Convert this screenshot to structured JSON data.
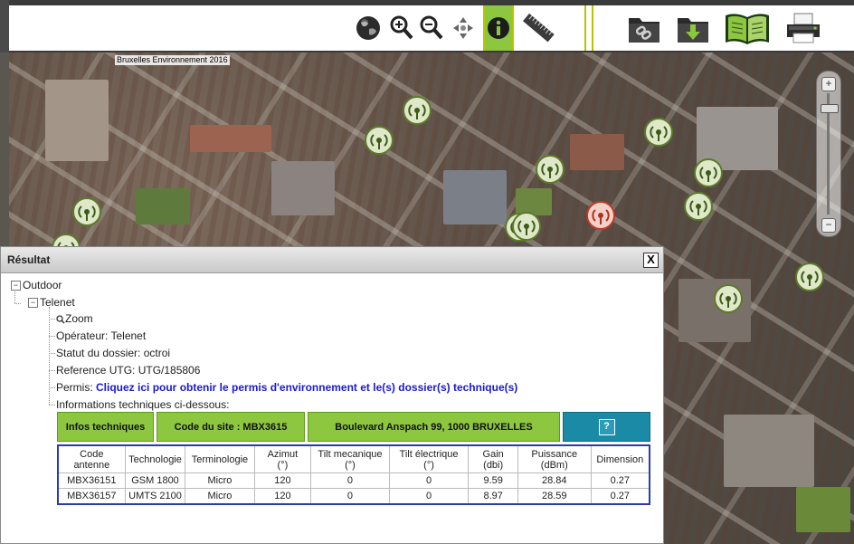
{
  "map": {
    "copyright": "Bruxelles Environnement 2016",
    "zoom": {
      "plus": "+",
      "minus": "−"
    }
  },
  "toolbar": {
    "buttons": [
      "globe-icon",
      "zoom-in-icon",
      "zoom-out-icon",
      "pan-icon",
      "info-icon",
      "ruler-icon",
      "link-folder-icon",
      "download-folder-icon",
      "book-icon",
      "printer-icon"
    ]
  },
  "panel": {
    "title": "Résultat",
    "close": "X",
    "tree": {
      "outdoor": "Outdoor",
      "operator_node": "Telenet",
      "zoom": "Zoom",
      "operateur": "Opérateur: Telenet",
      "statut": "Statut du dossier: octroi",
      "reference": "Reference UTG: UTG/185806",
      "permis_label": "Permis: ",
      "permis_link": "Cliquez ici pour obtenir le permis d'environnement et le(s) dossier(s) technique(s)",
      "infos_label": "Informations techniques ci-dessous:"
    },
    "infobar": {
      "infos": "Infos techniques",
      "code_site": "Code du site : MBX3615",
      "address": "Boulevard Anspach 99, 1000 BRUXELLES",
      "help": "?"
    },
    "table": {
      "headers": [
        [
          "Code",
          "antenne"
        ],
        [
          "Technologie"
        ],
        [
          "Terminologie"
        ],
        [
          "Azimut",
          "(°)"
        ],
        [
          "Tilt mecanique",
          "(°)"
        ],
        [
          "Tilt électrique",
          "(°)"
        ],
        [
          "Gain",
          "(dbi)"
        ],
        [
          "Puissance",
          "(dBm)"
        ],
        [
          "Dimension"
        ]
      ],
      "rows": [
        [
          "MBX36151",
          "GSM 1800",
          "Micro",
          "120",
          "0",
          "0",
          "9.59",
          "28.84",
          "0.27"
        ],
        [
          "MBX36157",
          "UMTS 2100",
          "Micro",
          "120",
          "0",
          "0",
          "8.97",
          "28.59",
          "0.27"
        ]
      ]
    }
  },
  "colors": {
    "accent_green": "#8dc63f",
    "help_blue": "#1a8aa6",
    "table_border": "#2a3ca8",
    "link": "#1a1ad0"
  }
}
